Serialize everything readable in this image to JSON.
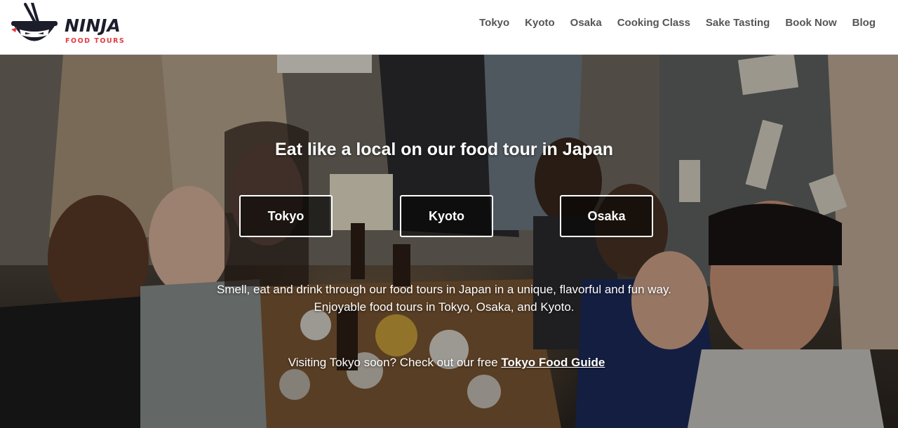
{
  "brand": {
    "name": "NINJA",
    "tagline": "FOOD TOURS",
    "colors": {
      "dark": "#1c1d2b",
      "accent": "#e23b3f"
    }
  },
  "nav": {
    "items": [
      {
        "label": "Tokyo"
      },
      {
        "label": "Kyoto"
      },
      {
        "label": "Osaka"
      },
      {
        "label": "Cooking Class"
      },
      {
        "label": "Sake Tasting"
      },
      {
        "label": "Book Now"
      },
      {
        "label": "Blog"
      }
    ]
  },
  "hero": {
    "heading": "Eat like a local on our food tour in Japan",
    "buttons": [
      {
        "label": "Tokyo"
      },
      {
        "label": "Kyoto"
      },
      {
        "label": "Osaka"
      }
    ],
    "description": "Smell, eat and drink through our food tours in Japan in a unique, flavorful and fun way. Enjoyable food tours in Tokyo, Osaka, and Kyoto.",
    "guide_prefix": "Visiting Tokyo soon? Check out our free ",
    "guide_link": "Tokyo Food Guide"
  }
}
